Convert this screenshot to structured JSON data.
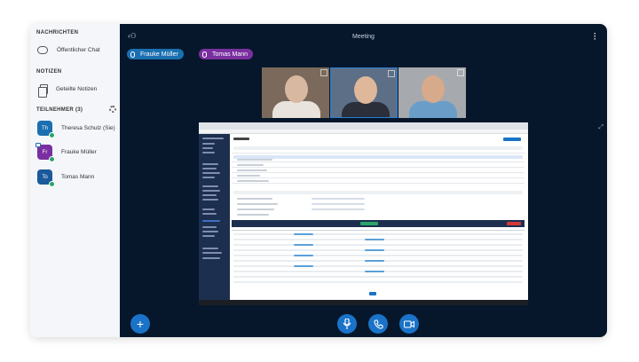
{
  "sidebar": {
    "messages_title": "NACHRICHTEN",
    "public_chat": "Öffentlicher Chat",
    "notes_title": "NOTIZEN",
    "shared_notes": "Geteilte Notizen",
    "participants_title": "TEILNEHMER (3)",
    "participants": [
      {
        "initials": "Th",
        "name": "Theresa Schulz",
        "suffix": "(Sie)",
        "color": "#1a6fb0"
      },
      {
        "initials": "Fr",
        "name": "Frauke Müller",
        "suffix": "",
        "color": "#7a2fa0"
      },
      {
        "initials": "To",
        "name": "Tomas Mann",
        "suffix": "",
        "color": "#1a5a9a"
      }
    ]
  },
  "header": {
    "title": "Meeting"
  },
  "speakers": [
    {
      "name": "Frauke Müller",
      "color": "#1a6fb0"
    },
    {
      "name": "Tomas Mann",
      "color": "#7a2fa0"
    }
  ],
  "video_tiles": [
    {
      "person": "woman with glasses",
      "bg": "#7b6a5c",
      "skin": "#d8b8a0",
      "shirt": "#e8e3dc"
    },
    {
      "person": "woman laughing",
      "bg": "#5d6f86",
      "skin": "#dfb79a",
      "shirt": "#2b2f3a"
    },
    {
      "person": "bearded man",
      "bg": "#a6a9ad",
      "skin": "#d6aa8a",
      "shirt": "#6a9ec8"
    }
  ],
  "controls": {
    "add_icon": "plus-icon",
    "mic_icon": "mic-icon",
    "phone_icon": "phone-icon",
    "video_icon": "video-icon"
  }
}
